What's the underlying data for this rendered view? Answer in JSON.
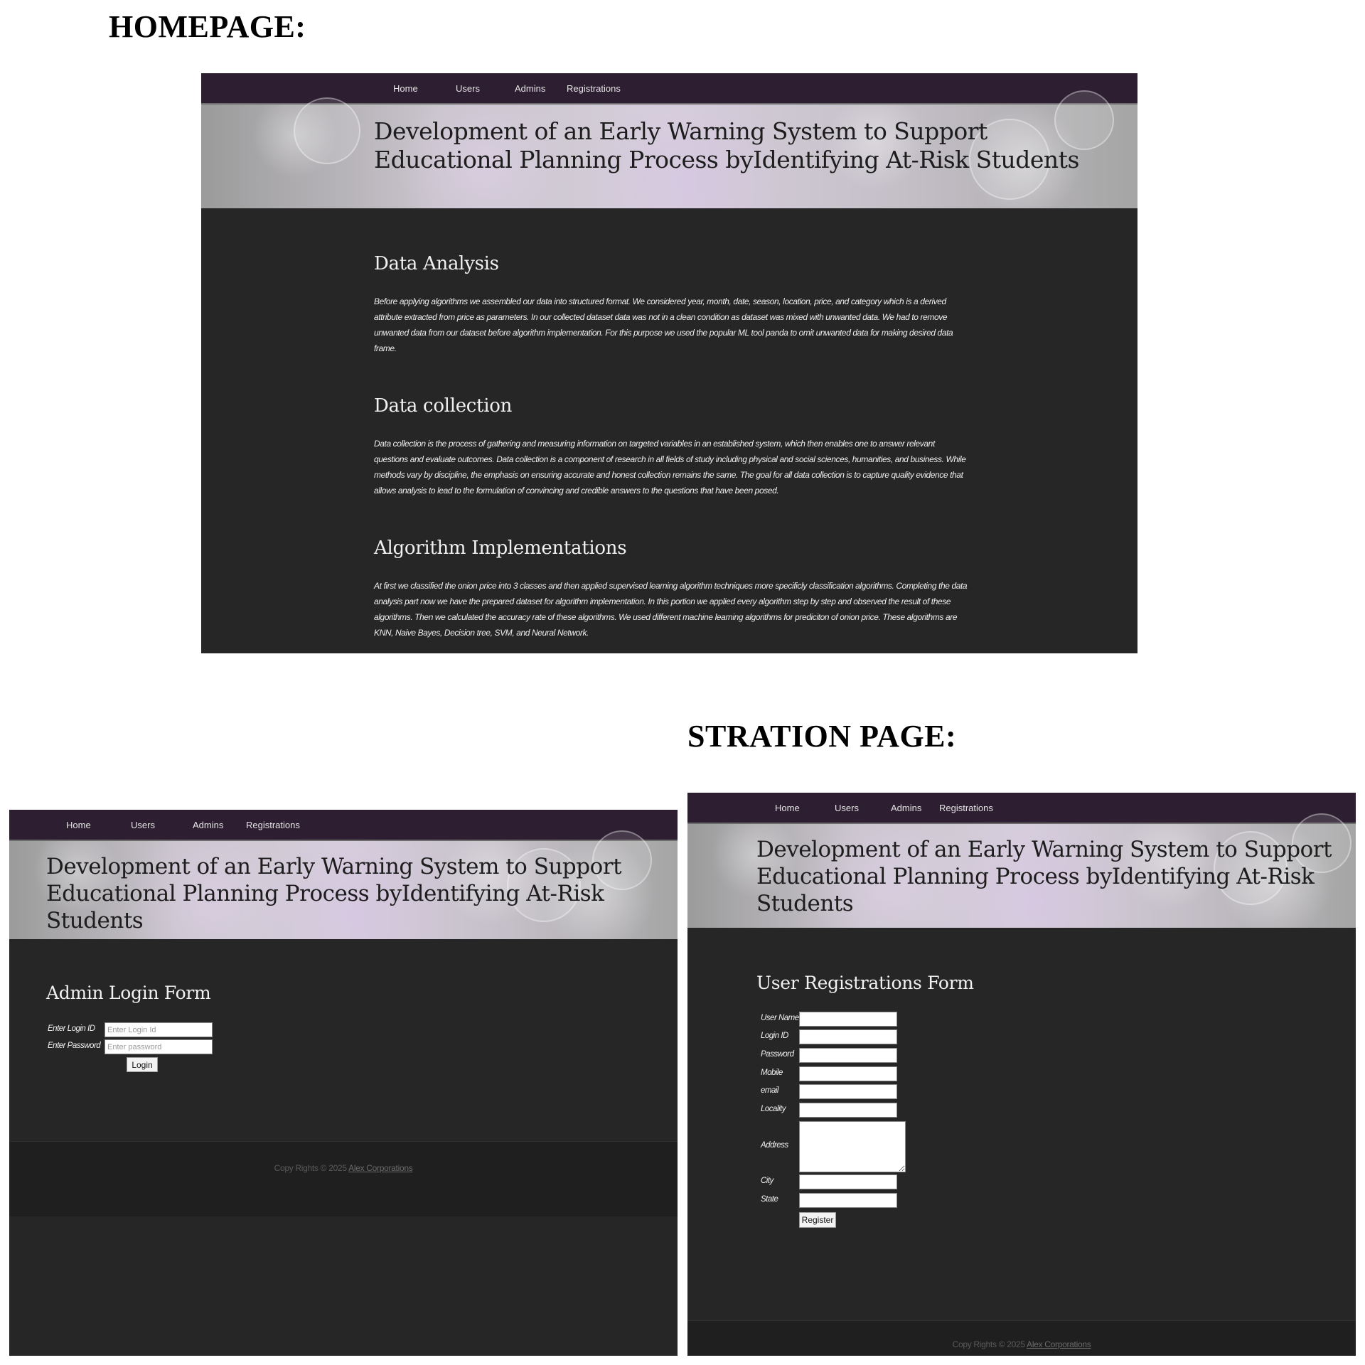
{
  "captions": {
    "homepage": "HOMEPAGE:",
    "registration": "STRATION PAGE:"
  },
  "nav": {
    "home": "Home",
    "users": "Users",
    "admins": "Admins",
    "registrations": "Registrations"
  },
  "banner": {
    "line1": "Development of an Early Warning System to Support",
    "line2": "Educational Planning Process byIdentifying At-Risk Students"
  },
  "homepage": {
    "sections": [
      {
        "heading": "Data Analysis",
        "body": "Before applying algorithms we assembled our data into structured format. We considered year, month, date, season, location, price, and category which is a derived attribute extracted from price as parameters. In our collected dataset data was not in a clean condition as dataset was mixed with unwanted data. We had to remove unwanted data from our dataset before algorithm implementation. For this purpose we used the popular ML tool panda to omit unwanted data for making desired data frame."
      },
      {
        "heading": "Data collection",
        "body": "Data collection is the process of gathering and measuring information on targeted variables in an established system, which then enables one to answer relevant questions and evaluate outcomes. Data collection is a component of research in all fields of study including physical and social sciences, humanities, and business. While methods vary by discipline, the emphasis on ensuring accurate and honest collection remains the same. The goal for all data collection is to capture quality evidence that allows analysis to lead to the formulation of convincing and credible answers to the questions that have been posed."
      },
      {
        "heading": "Algorithm Implementations",
        "body": "At first we classified the onion price into 3 classes and then applied supervised learning algorithm techniques more specificly classification algorithms. Completing the data analysis part now we have the prepared dataset for algorithm implementation. In this portion we applied every algorithm step by step and observed the result of these algorithms. Then we calculated the accuracy rate of these algorithms. We used different machine learning algorithms for prediciton of onion price. These algorithms are KNN, Naive Bayes, Decision tree, SVM, and Neural Network."
      }
    ]
  },
  "admin_login": {
    "title": "Admin Login Form",
    "login_id_label": "Enter Login ID",
    "login_id_placeholder": "Enter Login Id",
    "password_label": "Enter Password",
    "password_placeholder": "Enter password",
    "submit": "Login"
  },
  "footer": {
    "text": "Copy Rights © 2025",
    "link": "Alex Corporations"
  },
  "user_registration": {
    "title": "User Registrations Form",
    "fields": {
      "user_name": "User Name",
      "login_id": "Login ID",
      "password": "Password",
      "mobile": "Mobile",
      "email": "email",
      "locality": "Locality",
      "address": "Address",
      "city": "City",
      "state": "State"
    },
    "submit": "Register"
  },
  "colors": {
    "nav_bg": "#2d1f31",
    "page_bg": "#262626",
    "footer_bg": "#1f1f1f",
    "text": "#eeeeee"
  }
}
